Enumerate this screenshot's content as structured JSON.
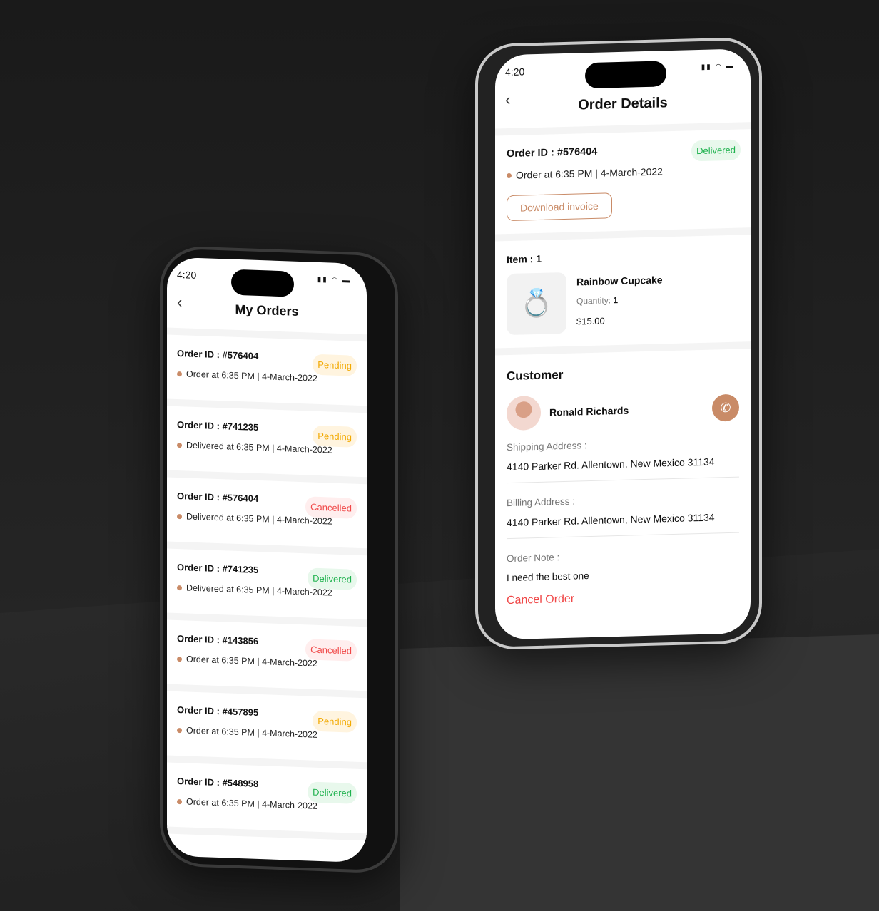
{
  "left_phone": {
    "status_time": "4:20",
    "title": "My Orders",
    "orders": [
      {
        "id": "Order ID : #576404",
        "meta": "Order at 6:35 PM | 4-March-2022",
        "status": "Pending",
        "kind": "pending"
      },
      {
        "id": "Order ID : #741235",
        "meta": "Delivered at 6:35 PM | 4-March-2022",
        "status": "Pending",
        "kind": "pending"
      },
      {
        "id": "Order ID : #576404",
        "meta": "Delivered at 6:35 PM | 4-March-2022",
        "status": "Cancelled",
        "kind": "cancelled"
      },
      {
        "id": "Order ID : #741235",
        "meta": "Delivered at 6:35 PM | 4-March-2022",
        "status": "Delivered",
        "kind": "delivered"
      },
      {
        "id": "Order ID : #143856",
        "meta": "Order at 6:35 PM | 4-March-2022",
        "status": "Cancelled",
        "kind": "cancelled"
      },
      {
        "id": "Order ID : #457895",
        "meta": "Order at 6:35 PM | 4-March-2022",
        "status": "Pending",
        "kind": "pending"
      },
      {
        "id": "Order ID : #548958",
        "meta": "Order at 6:35 PM | 4-March-2022",
        "status": "Delivered",
        "kind": "delivered"
      }
    ]
  },
  "right_phone": {
    "status_time": "4:20",
    "title": "Order Details",
    "order_id": "Order ID : #576404",
    "status": "Delivered",
    "meta": "Order at 6:35 PM | 4-March-2022",
    "download_invoice": "Download invoice",
    "item_count": "Item : 1",
    "item": {
      "name": "Rainbow Cupcake",
      "quantity_label": "Quantity:",
      "quantity": "1",
      "price": "$15.00"
    },
    "customer_heading": "Customer",
    "customer_name": "Ronald Richards",
    "shipping_label": "Shipping Address :",
    "shipping_address": "4140 Parker Rd. Allentown, New Mexico 31134",
    "billing_label": "Billing Address :",
    "billing_address": "4140 Parker Rd. Allentown, New Mexico 31134",
    "note_label": "Order Note :",
    "note": "I need the best one",
    "cancel_order": "Cancel Order"
  },
  "colors": {
    "accent": "#c98b67",
    "pending": "#f2a900",
    "cancelled": "#f04848",
    "delivered": "#1fb24e"
  }
}
